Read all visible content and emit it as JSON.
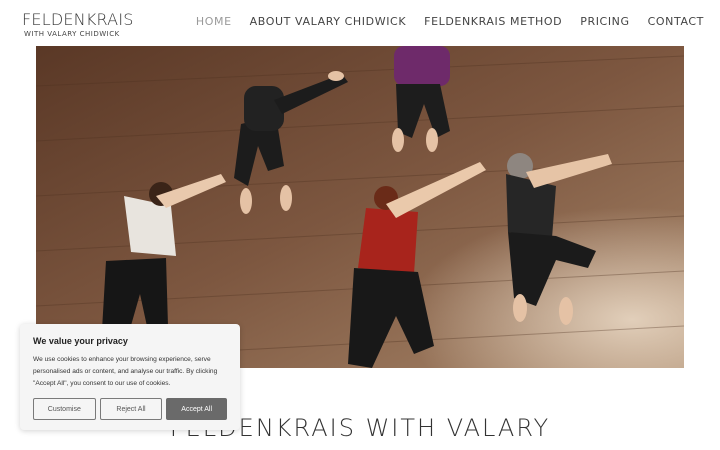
{
  "logo": {
    "main": "FELDENKRAIS",
    "sub": "WITH VALARY CHIDWICK"
  },
  "nav": {
    "items": [
      {
        "label": "HOME",
        "active": true
      },
      {
        "label": "ABOUT VALARY CHIDWICK",
        "active": false
      },
      {
        "label": "FELDENKRAIS METHOD",
        "active": false
      },
      {
        "label": "PRICING",
        "active": false
      },
      {
        "label": "CONTACT",
        "active": false
      }
    ]
  },
  "hero": {
    "icon": "hero-photo-class-on-floor"
  },
  "page": {
    "title": "FELDENKRAIS WITH VALARY"
  },
  "cookie": {
    "title": "We value your privacy",
    "text": "We use cookies to enhance your browsing experience, serve personalised ads or content, and analyse our traffic. By clicking \"Accept All\", you consent to our use of cookies.",
    "customise_label": "Customise",
    "reject_label": "Reject All",
    "accept_label": "Accept All"
  },
  "colors": {
    "accept_bg": "#6a6a6a",
    "nav_active": "#9a9a9a",
    "banner_bg": "#f5f5f5"
  }
}
